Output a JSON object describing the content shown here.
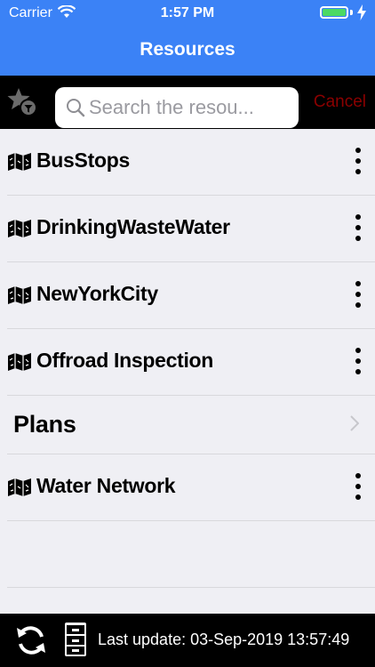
{
  "status_bar": {
    "carrier": "Carrier",
    "time": "1:57 PM",
    "battery_color": "#4cd964"
  },
  "header": {
    "title": "Resources",
    "background": "#3b82f6"
  },
  "search": {
    "placeholder": "Search the resou...",
    "cancel_label": "Cancel",
    "cancel_color": "#8b0000"
  },
  "list": {
    "items": [
      {
        "label": "BusStops",
        "icon": "map-icon",
        "kind": "resource"
      },
      {
        "label": "DrinkingWasteWater",
        "icon": "map-icon",
        "kind": "resource"
      },
      {
        "label": "NewYorkCity",
        "icon": "map-icon",
        "kind": "resource"
      },
      {
        "label": "Offroad Inspection",
        "icon": "map-icon",
        "kind": "resource"
      },
      {
        "label": "Plans",
        "icon": "chevron-right-icon",
        "kind": "folder"
      },
      {
        "label": "Water Network",
        "icon": "map-icon",
        "kind": "resource"
      }
    ]
  },
  "footer": {
    "last_update": "Last update: 03-Sep-2019 13:57:49"
  }
}
